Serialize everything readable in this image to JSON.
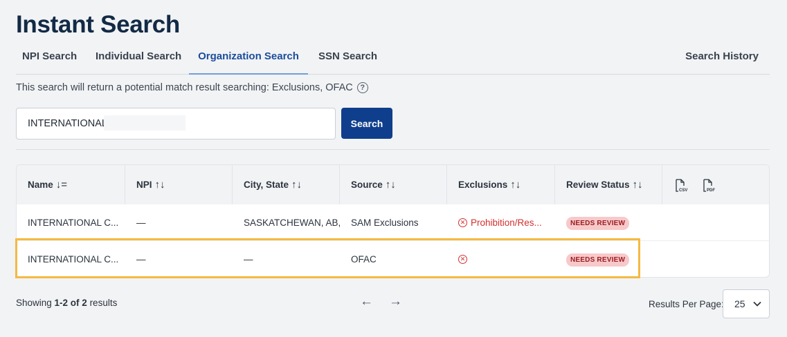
{
  "page": {
    "title": "Instant Search"
  },
  "tabs": [
    {
      "label": "NPI Search"
    },
    {
      "label": "Individual Search"
    },
    {
      "label": "Organization Search",
      "active": true
    },
    {
      "label": "SSN Search"
    }
  ],
  "history": {
    "label": "Search History"
  },
  "info": {
    "text": "This search will return a potential match result searching: Exclusions, OFAC",
    "help_icon": "question-circle-icon"
  },
  "search": {
    "value": "INTERNATIONAL",
    "button_label": "Search"
  },
  "table": {
    "headers": {
      "name": "Name",
      "npi": "NPI",
      "city": "City, State",
      "source": "Source",
      "exclusions": "Exclusions",
      "review": "Review Status"
    },
    "export_icons": [
      "csv-file-icon",
      "pdf-file-icon"
    ],
    "rows": [
      {
        "name": "INTERNATIONAL C...",
        "npi": "—",
        "city": "SASKATCHEWAN, AB,",
        "source": "SAM Exclusions",
        "exclusion": "Prohibition/Res...",
        "status": "NEEDS REVIEW"
      },
      {
        "name": "INTERNATIONAL C...",
        "npi": "—",
        "city": "—",
        "source": "OFAC",
        "exclusion": "",
        "status": "NEEDS REVIEW"
      }
    ]
  },
  "footer": {
    "showing_prefix": "Showing ",
    "showing_range": "1-2 of 2",
    "showing_suffix": " results",
    "prev": "←",
    "next": "→",
    "per_page_label": "Results Per Page:",
    "per_page_value": "25"
  },
  "colors": {
    "accent": "#0f3e8c",
    "title": "#122a45",
    "highlight": "#f5b942",
    "error": "#d32f2f",
    "badge_bg": "#f7c9ca"
  }
}
